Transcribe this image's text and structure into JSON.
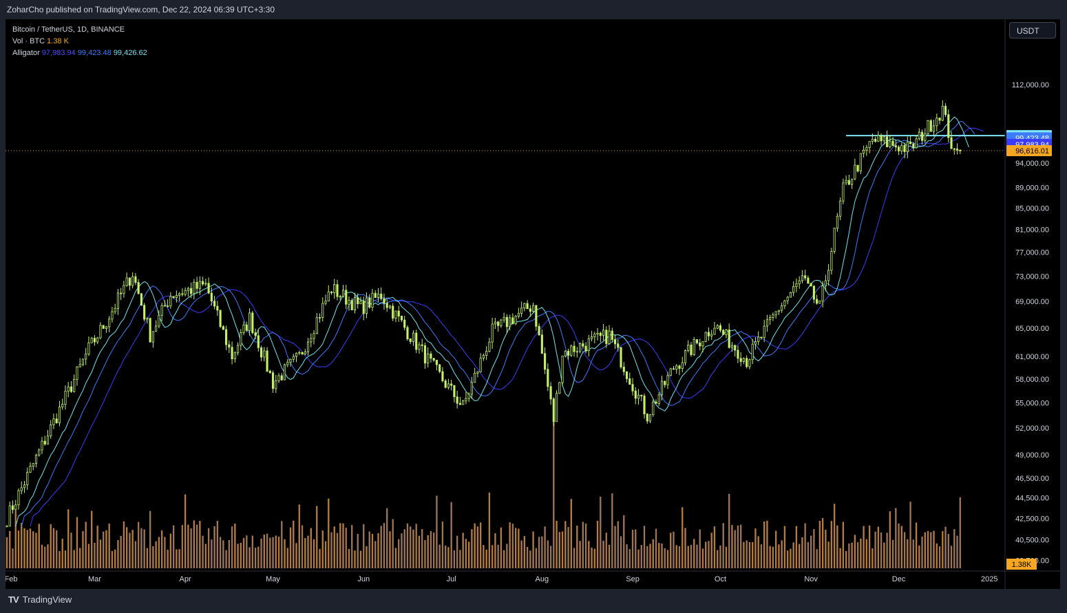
{
  "header": {
    "publisher_line": "ZoharCho published on TradingView.com, Dec 22, 2024 06:39 UTC+3:30"
  },
  "legend": {
    "symbol_line": "Bitcoin / TetherUS, 1D, BINANCE",
    "volume_label": "Vol · BTC",
    "volume_value": "1.38 K",
    "alligator_label": "Alligator",
    "alligator_jaw": "97,983.94",
    "alligator_teeth": "99,423.48",
    "alligator_lips": "99,426.62"
  },
  "currency_button": "USDT",
  "footer": {
    "logo_text": "TradingView",
    "logo_mark": "TV"
  },
  "colors": {
    "candle": "#c5f06a",
    "volume": "#d4924e",
    "jaw": "#3b3bff",
    "teeth": "#3d7bff",
    "lips": "#6fe6f0",
    "resistance": "#7fe8f8",
    "last_price": "#f5a623",
    "axis_text": "#d1d4dc"
  },
  "chart_data": {
    "type": "candlestick",
    "title": "Bitcoin / TetherUS, 1D, BINANCE",
    "y_scale": "log",
    "ylim": [
      38600,
      116000
    ],
    "y_ticks": [
      {
        "value": 112000,
        "label": "112,000.00"
      },
      {
        "value": 94000,
        "label": "94,000.00"
      },
      {
        "value": 89000,
        "label": "89,000.00"
      },
      {
        "value": 85000,
        "label": "85,000.00"
      },
      {
        "value": 81000,
        "label": "81,000.00"
      },
      {
        "value": 77000,
        "label": "77,000.00"
      },
      {
        "value": 73000,
        "label": "73,000.00"
      },
      {
        "value": 69000,
        "label": "69,000.00"
      },
      {
        "value": 65000,
        "label": "65,000.00"
      },
      {
        "value": 61000,
        "label": "61,000.00"
      },
      {
        "value": 58000,
        "label": "58,000.00"
      },
      {
        "value": 55000,
        "label": "55,000.00"
      },
      {
        "value": 52000,
        "label": "52,000.00"
      },
      {
        "value": 49000,
        "label": "49,000.00"
      },
      {
        "value": 46500,
        "label": "46,500.00"
      },
      {
        "value": 44500,
        "label": "44,500.00"
      },
      {
        "value": 42500,
        "label": "42,500.00"
      },
      {
        "value": 40500,
        "label": "40,500.00"
      },
      {
        "value": 38700,
        "label": "38,700.00"
      }
    ],
    "price_badges": [
      {
        "value": 99920.83,
        "label": "99,920.83",
        "color": "#7fe8f8"
      },
      {
        "value": 99426.62,
        "label": "99,426.62",
        "color": "#6fe6f0"
      },
      {
        "value": 99423.48,
        "label": "99,423.48",
        "color": "#3d7bff"
      },
      {
        "value": 97983.94,
        "label": "97,983.94",
        "color": "#3b3bff"
      },
      {
        "value": 96616.01,
        "label": "96,616.01",
        "color": "#f5a623"
      }
    ],
    "volume_badge": "1.38K",
    "x_labels": [
      "Feb",
      "Mar",
      "Apr",
      "May",
      "Jun",
      "Jul",
      "Aug",
      "Sep",
      "Oct",
      "Nov",
      "Dec",
      "2025"
    ],
    "key_points": [
      [
        "2024-01-31",
        42500
      ],
      [
        "2024-02-15",
        52000
      ],
      [
        "2024-02-28",
        62000
      ],
      [
        "2024-03-05",
        66000
      ],
      [
        "2024-03-14",
        73500
      ],
      [
        "2024-03-20",
        64000
      ],
      [
        "2024-03-27",
        70000
      ],
      [
        "2024-04-08",
        71500
      ],
      [
        "2024-04-17",
        61000
      ],
      [
        "2024-04-23",
        66500
      ],
      [
        "2024-05-01",
        57500
      ],
      [
        "2024-05-10",
        61000
      ],
      [
        "2024-05-21",
        71000
      ],
      [
        "2024-05-31",
        68000
      ],
      [
        "2024-06-07",
        70000
      ],
      [
        "2024-06-24",
        60000
      ],
      [
        "2024-07-05",
        54500
      ],
      [
        "2024-07-15",
        64500
      ],
      [
        "2024-07-29",
        68500
      ],
      [
        "2024-08-05",
        53000
      ],
      [
        "2024-08-08",
        61500
      ],
      [
        "2024-08-24",
        64000
      ],
      [
        "2024-09-06",
        53500
      ],
      [
        "2024-09-15",
        59500
      ],
      [
        "2024-09-29",
        65500
      ],
      [
        "2024-10-10",
        60500
      ],
      [
        "2024-10-21",
        68000
      ],
      [
        "2024-10-29",
        72500
      ],
      [
        "2024-11-04",
        68000
      ],
      [
        "2024-11-12",
        88500
      ],
      [
        "2024-11-22",
        99000
      ],
      [
        "2024-12-05",
        97000
      ],
      [
        "2024-12-16",
        106000
      ],
      [
        "2024-12-20",
        95500
      ],
      [
        "2024-12-22",
        96616
      ]
    ],
    "resistance_level": 99920.83,
    "last_price": 96616.01,
    "alligator": {
      "jaw": 97983.94,
      "teeth": 99423.48,
      "lips": 99426.62
    }
  }
}
